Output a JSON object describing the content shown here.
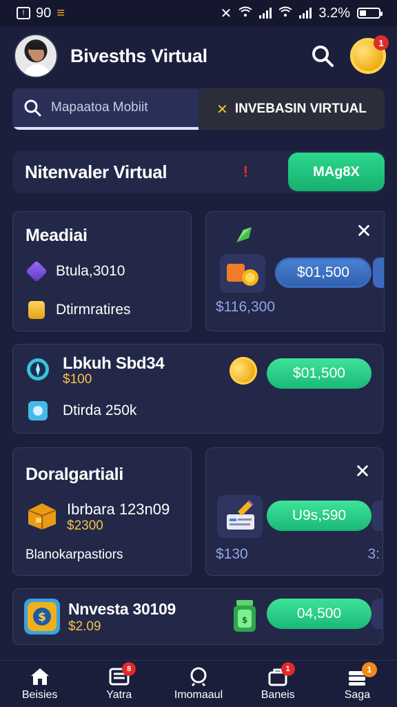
{
  "status_bar": {
    "time": "90",
    "battery": "3.2%"
  },
  "header": {
    "title": "Bivesths Virtual",
    "coin_badge": "1"
  },
  "tabs": [
    {
      "label": "Mapaatoa Mobiit"
    },
    {
      "label": "INVEBASIN VIRTUAL"
    }
  ],
  "banner": {
    "title": "Nitenvaler Virtual",
    "mark": "!",
    "button": "MAg8X"
  },
  "cards": {
    "card1": {
      "title": "Meadiai",
      "rows": [
        {
          "text": "Btula,3010"
        },
        {
          "text": "Dtirmratires"
        }
      ]
    },
    "card2": {
      "button": "$01,500",
      "amount": "$116,300"
    },
    "card3": {
      "title": "Lbkuh Sbd34",
      "subtitle": "$100",
      "button": "$01,500",
      "row": "Dtirda 250k"
    },
    "card4": {
      "title": "Doralgartiali",
      "item_title": "Ibrbara 123n09",
      "item_price": "$2300",
      "footer": "Blanokarpastiors"
    },
    "card5": {
      "button": "U9s,590",
      "amount": "$130",
      "amount_clipped": "3:"
    },
    "card6": {
      "title": "Nnvesta 30109",
      "subtitle": "$2.09",
      "button": "04,500"
    }
  },
  "bottom_nav": [
    {
      "label": "Beisies",
      "badge": ""
    },
    {
      "label": "Yatra",
      "badge": "8"
    },
    {
      "label": "Imomaaul",
      "badge": ""
    },
    {
      "label": "Baneis",
      "badge": "1"
    },
    {
      "label": "Saga",
      "badge": "1"
    }
  ],
  "colors": {
    "background": "#1b1f3c",
    "card": "#232848",
    "green": "#1fc47f",
    "blue": "#3c6bc0",
    "gold": "#f5c445",
    "red": "#e02b2b"
  }
}
